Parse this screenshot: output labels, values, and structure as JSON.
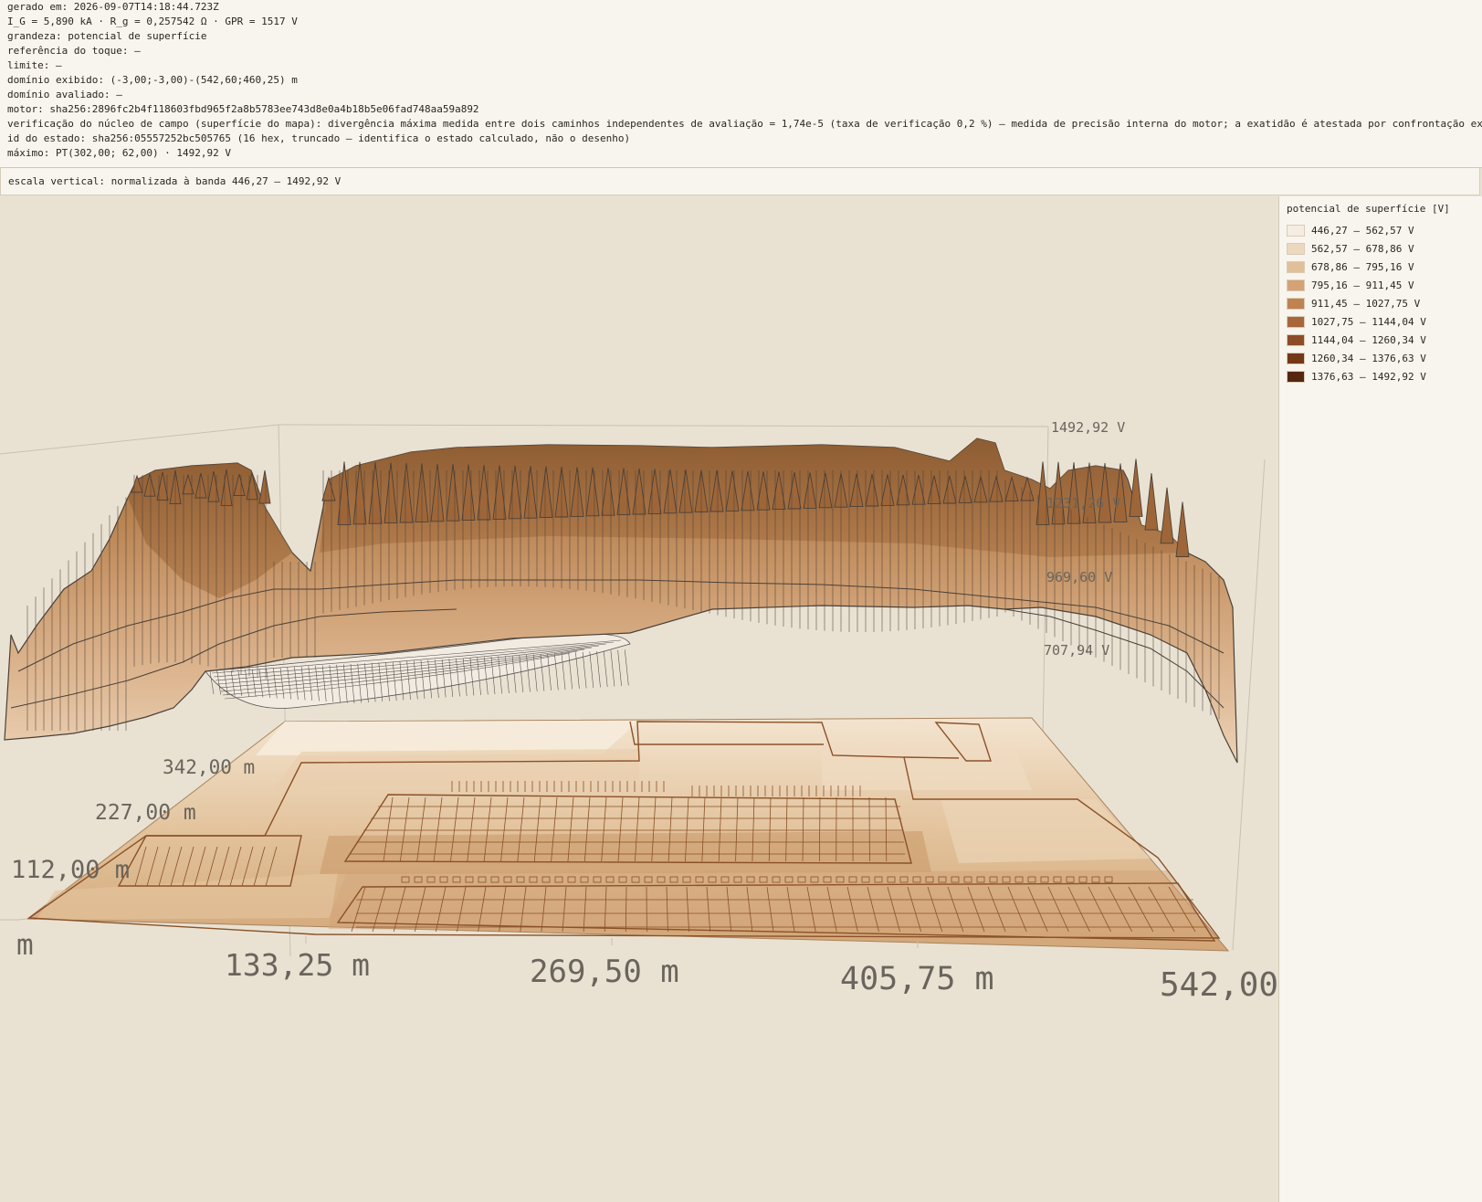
{
  "meta": {
    "lines": [
      "gerado em: 2026-09-07T14:18:44.723Z",
      "I_G = 5,890 kA · R_g = 0,257542 Ω · GPR = 1517 V",
      "grandeza: potencial de superfície",
      "referência do toque: —",
      "limite: —",
      "domínio exibido: (-3,00;-3,00)-(542,60;460,25) m",
      "domínio avaliado: —",
      "motor: sha256:2896fc2b4f118603fbd965f2a8b5783ee743d8e0a4b18b5e06fad748aa59a892",
      "verificação do núcleo de campo (superfície do mapa): divergência máxima medida entre dois caminhos independentes de avaliação = 1,74e-5 (taxa de verificação 0,2 %) — medida de precisão interna do motor; a exatidão é atestada por confrontação ext",
      "id do estado: sha256:05557252bc505765 (16 hex, truncado — identifica o estado calculado, não o desenho)",
      "máximo: PT(302,00; 62,00) · 1492,92 V"
    ]
  },
  "scale_note": "escala vertical: normalizada à banda 446,27 – 1492,92 V",
  "legend": {
    "title": "potencial de superfície [V]",
    "items": [
      {
        "label": "446,27 – 562,57 V",
        "color": "#f5ede1"
      },
      {
        "label": "562,57 – 678,86 V",
        "color": "#ecd7bf"
      },
      {
        "label": "678,86 – 795,16 V",
        "color": "#e1bf98"
      },
      {
        "label": "795,16 – 911,45 V",
        "color": "#d4a275"
      },
      {
        "label": "911,45 – 1027,75 V",
        "color": "#c08250"
      },
      {
        "label": "1027,75 – 1144,04 V",
        "color": "#a8663a"
      },
      {
        "label": "1144,04 – 1260,34 V",
        "color": "#8c4d26"
      },
      {
        "label": "1260,34 – 1376,63 V",
        "color": "#723818"
      },
      {
        "label": "1376,63 – 1492,92 V",
        "color": "#56260e"
      }
    ]
  },
  "plot": {
    "z_ticks": [
      "1492,92 V",
      "1231,26 V",
      "969,60 V",
      "707,94 V"
    ],
    "x_ticks": [
      "m",
      "133,25 m",
      "269,50 m",
      "405,75 m",
      "542,00"
    ],
    "y_ticks": [
      "342,00 m",
      "227,00 m",
      "112,00 m"
    ],
    "colors": {
      "outline": "#4a4038",
      "mesh": "#5a5550",
      "frame": "#c9c0ae",
      "tick_text": "#6a645c"
    }
  }
}
